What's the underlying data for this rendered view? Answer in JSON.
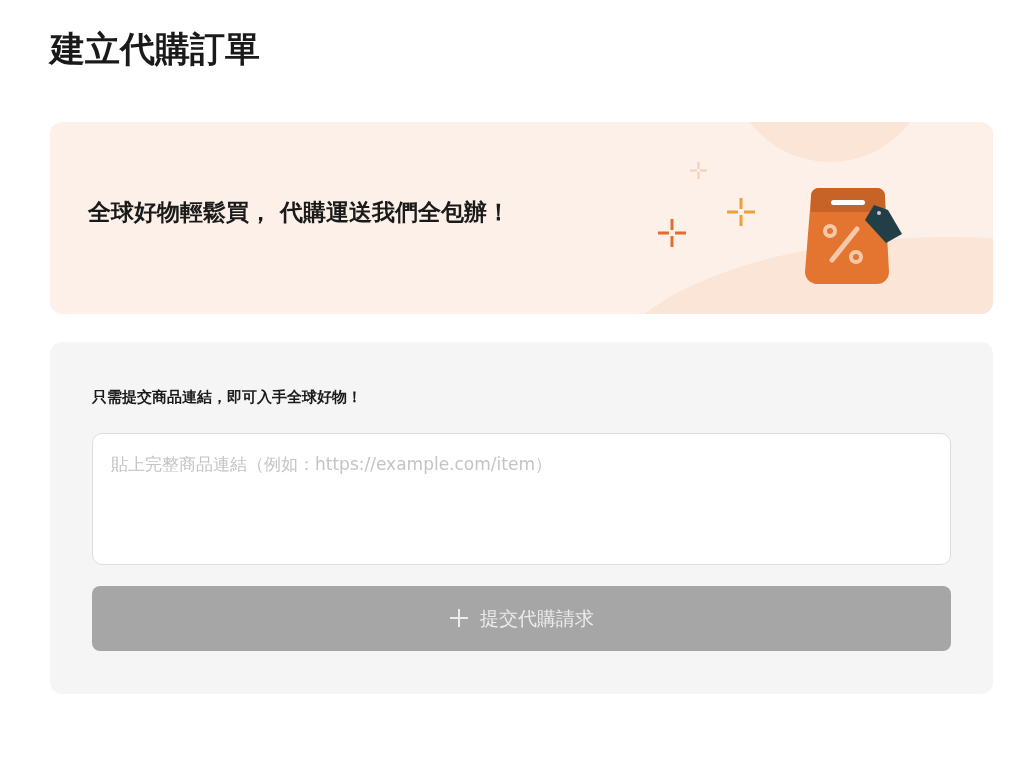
{
  "page_title": "建立代購訂單",
  "banner": {
    "text": "全球好物輕鬆買， 代購運送我們全包辦！"
  },
  "form": {
    "label": "只需提交商品連結，即可入手全球好物！",
    "link_field": {
      "placeholder": "貼上完整商品連結（例如：https://example.com/item）"
    },
    "submit_button": {
      "label": "提交代購請求",
      "disabled": true
    }
  }
}
